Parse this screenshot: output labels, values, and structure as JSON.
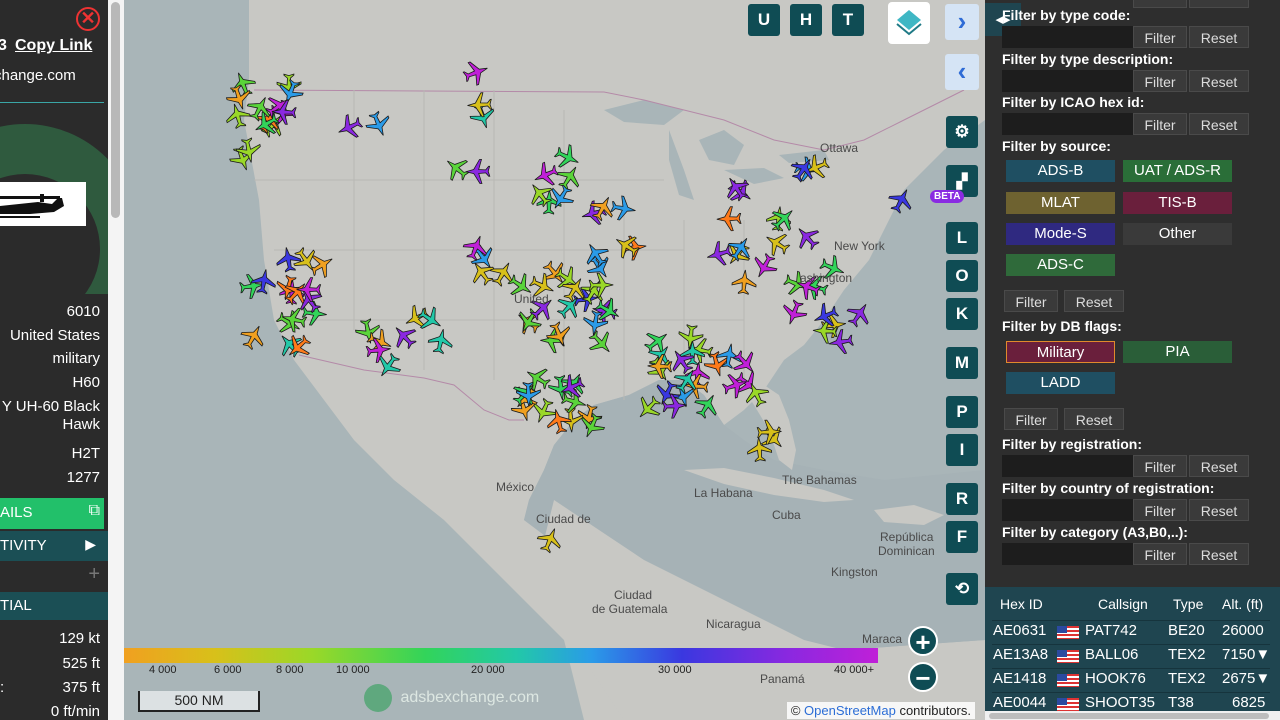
{
  "left_panel": {
    "copy_link_prefix": "3",
    "copy_link": "Copy Link",
    "site_url": "change.com",
    "close_icon": "close-icon",
    "info": {
      "squawk": "6010",
      "country": "United States",
      "category": "military",
      "type_code": "H60",
      "type_line1": "Y UH-60 Black",
      "type_line2": "Hawk",
      "wtc": "H2T",
      "year": "1277"
    },
    "details_label": "AILS",
    "activity_label": "TIVITY",
    "spatial_label": "TIAL",
    "plus_label": "+",
    "telemetry": {
      "speed": "129 kt",
      "altitude": "525 ft",
      "alt_prefix": ":",
      "altitude2": "375 ft",
      "vrate": "0 ft/min"
    }
  },
  "map": {
    "labels": {
      "united": "United",
      "mexico": "México",
      "la_habana": "La Habana",
      "bahamas": "The Bahamas",
      "cuba": "Cuba",
      "ciudad_de": "Ciudad de",
      "ciudad": "Ciudad",
      "de_guatemala": "de Guatemala",
      "nicaragua": "Nicaragua",
      "panama": "Panamá",
      "maracaibo": "Maraca",
      "kingston": "Kingston",
      "republica": "República",
      "dominicana": "Dominican",
      "new_york": "New York",
      "washington": "ashington",
      "ottawa": "Ottawa"
    },
    "top_buttons": [
      "U",
      "H",
      "T"
    ],
    "side_buttons": [
      "L",
      "O",
      "K",
      "M",
      "P",
      "I",
      "R",
      "F"
    ],
    "beta_label": "BETA",
    "scale_label": "500 NM",
    "logo_text": "adsbexchange.com",
    "attribution_prefix": "©",
    "attribution_link": "OpenStreetMap",
    "attribution_suffix": "contributors.",
    "legend_ticks": [
      "4 000",
      "6 000",
      "8 000",
      "10 000",
      "20 000",
      "30 000",
      "40 000+"
    ]
  },
  "right_panel": {
    "toggle_label": "◂▸",
    "filters": [
      {
        "label": "Filter by type code:"
      },
      {
        "label": "Filter by type description:"
      },
      {
        "label": "Filter by ICAO hex id:"
      }
    ],
    "filter_btn": "Filter",
    "reset_btn": "Reset",
    "source_label": "Filter by source:",
    "sources": [
      "ADS-B",
      "UAT / ADS-R",
      "MLAT",
      "TIS-B",
      "Mode-S",
      "Other",
      "ADS-C"
    ],
    "dbflags_label": "Filter by DB flags:",
    "dbflags": [
      "Military",
      "PIA",
      "LADD"
    ],
    "registration_label": "Filter by registration:",
    "country_label": "Filter by country of registration:",
    "category_label": "Filter by category (A3,B0,..):",
    "table": {
      "headers": [
        "Hex ID",
        "Callsign",
        "Type",
        "Alt. (ft)"
      ],
      "rows": [
        {
          "hex": "AE0631",
          "callsign": "PAT742",
          "type": "BE20",
          "alt": "26000"
        },
        {
          "hex": "AE13A8",
          "callsign": "BALL06",
          "type": "TEX2",
          "alt": "7150▼"
        },
        {
          "hex": "AE1418",
          "callsign": "HOOK76",
          "type": "TEX2",
          "alt": "2675▼"
        },
        {
          "hex": "AE0044",
          "callsign": "SHOOT35",
          "type": "T38",
          "alt": "6825"
        }
      ]
    }
  }
}
